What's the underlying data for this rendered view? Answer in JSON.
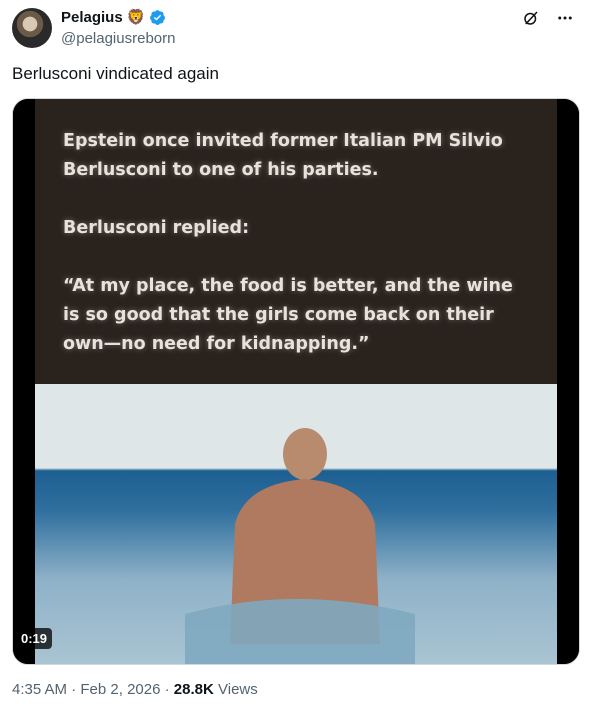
{
  "author": {
    "display_name": "Pelagius",
    "emoji": "🦁",
    "handle": "@pelagiusreborn"
  },
  "icons": {
    "grok": "grok-icon",
    "more": "more-icon",
    "verified": "verified-badge-icon"
  },
  "tweet": {
    "text": "Berlusconi vindicated again"
  },
  "media": {
    "caption_lines": [
      "Epstein once invited former Italian PM Silvio Berlusconi to one of his parties.",
      "Berlusconi replied:",
      "“At my place, the food is better, and the wine is so good that the girls come back on their own—no need for kidnapping.”"
    ],
    "duration": "0:19"
  },
  "meta": {
    "time": "4:35 AM",
    "separator": "·",
    "date": "Feb 2, 2026",
    "views_count": "28.8K",
    "views_label": "Views"
  },
  "colors": {
    "text_primary": "#0f1419",
    "text_secondary": "#536471",
    "verified_blue": "#1d9bf0",
    "caption_bg": "#2a221d"
  }
}
